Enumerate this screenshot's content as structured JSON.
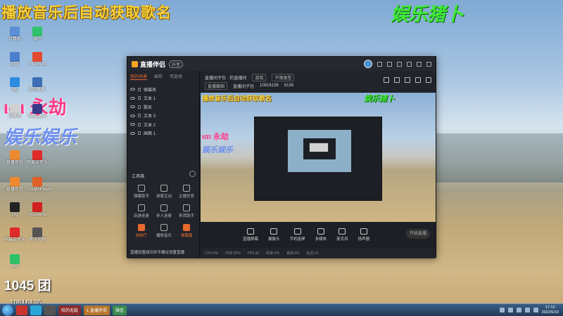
{
  "overlay": {
    "title": "播放音乐后自动获取歌名",
    "brand": "娱乐猪卜",
    "pink_text": "ιαι 永劫",
    "blue_text": "娱乐娱乐",
    "room_id": "1045 团",
    "room_id_sub": "10616136"
  },
  "desktop_icons": [
    {
      "label": "计算机",
      "color": "#5a8fd6"
    },
    {
      "label": "微信",
      "color": "#2ec26a"
    },
    {
      "label": "网络",
      "color": "#4a7fd0"
    },
    {
      "label": "Microsoft",
      "color": "#e04a2e"
    },
    {
      "label": "QQ",
      "color": "#2d8be0"
    },
    {
      "label": "控制面板",
      "color": "#3d6fb6"
    },
    {
      "label": "回收站",
      "color": "#d0d0d0"
    },
    {
      "label": "Wallpaper",
      "color": "#3a3a8a"
    },
    {
      "label": "直播伴侣",
      "color": "#f08a2e"
    },
    {
      "label": "网易云音乐",
      "color": "#e02a2a"
    },
    {
      "label": "直播伴侣",
      "color": "#f08a2e"
    },
    {
      "label": "DouyinPlayer",
      "color": "#e0602a"
    },
    {
      "label": "QQ",
      "color": "#222"
    },
    {
      "label": "mouseinc",
      "color": "#d02020"
    },
    {
      "label": "网易云音乐",
      "color": "#e02a2a"
    },
    {
      "label": "腾讯视频",
      "color": "#555"
    },
    {
      "label": "360",
      "color": "#2ec26a"
    }
  ],
  "window": {
    "app_name": "直播伴侣",
    "version": "抖音",
    "left_tabs": [
      "我的场景",
      "画布",
      "可选场"
    ],
    "sources": [
      "弹幕务",
      "文本 1",
      "歌名",
      "文本 3",
      "文本 2",
      "画面 1"
    ],
    "tools_label": "工具箱",
    "tools": [
      {
        "label": "弹幕助手",
        "hot": false
      },
      {
        "label": "游客互动",
        "hot": false
      },
      {
        "label": "主播任务",
        "hot": false
      },
      {
        "label": "玩游连麦",
        "hot": false
      },
      {
        "label": "多人连麦",
        "hot": false
      },
      {
        "label": "带货助手",
        "hot": false
      },
      {
        "label": "放映厅",
        "hot": true
      },
      {
        "label": "播放音乐",
        "hot": false
      },
      {
        "label": "弹幕魔",
        "hot": true
      }
    ],
    "info": {
      "line1": "直播间子包 · 的直播间",
      "tag1": "游戏",
      "tag2": "不限类型",
      "line2_a": "直播截图",
      "line2_b": "直播间子包",
      "line2_c": "10616136",
      "line2_d": "6136"
    },
    "preview": {
      "title": "播放音乐后自动获取歌名",
      "brand": "娱乐猪卜",
      "pink": "ιαι 永劫",
      "blue": "娱乐娱乐"
    },
    "controls": [
      "直播屏幕",
      "摄像头",
      "手机投屏",
      "多媒体",
      "麦克风",
      "扬声器"
    ],
    "start_label": "开始直播",
    "notice": "直播设置成功并不建议设置直播",
    "status": [
      "CPU:6%",
      "内存:32%",
      "FPS:30",
      "码率:4%",
      "丢帧:0%",
      "延迟:01"
    ]
  },
  "taskbar": {
    "items": [
      "哈的无敌",
      "1 直播伴侣",
      "微信"
    ],
    "time": "17:12",
    "date": "2022/5/10"
  }
}
